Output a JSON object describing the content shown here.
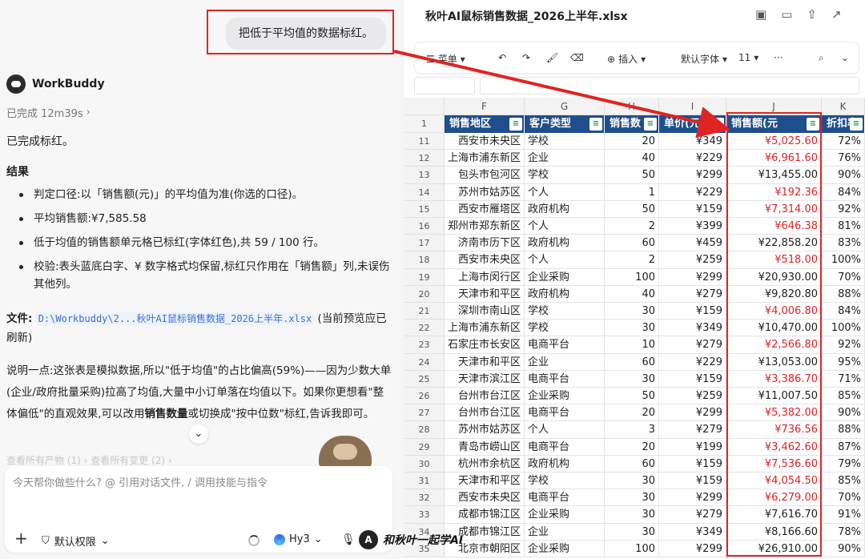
{
  "chat": {
    "user_message": "把低于平均值的数据标红。",
    "brand": "WorkBuddy",
    "status": "已完成 12m39s",
    "status_chevron": "›",
    "done_text": "已完成标红。",
    "result_title": "结果",
    "bullets": [
      "判定口径:以「销售额(元)」的平均值为准(你选的口径)。",
      "平均销售额:¥7,585.58",
      "低于均值的销售额单元格已标红(字体红色),共 59 / 100 行。",
      "校验:表头蓝底白字、¥ 数字格式均保留,标红只作用在「销售额」列,未误伤其他列。"
    ],
    "file_label": "文件:",
    "file_link": "D:\\Workbuddy\\2...秋叶AI鼠标销售数据_2026上半年.xlsx",
    "file_suffix": "(当前预览应已刷新)",
    "note_1": "说明一点:这张表是模拟数据,所以\"低于均值\"的占比偏高(59%)——因为少数大单(企业/政府批量采购)拉高了均值,大量中小订单落在均值以下。如果你更想看\"整体偏低\"的直观效果,可以改用",
    "note_bold_1": "销售数量",
    "note_2": "或切换成\"按中位数\"标红,告诉我即可。",
    "faded_links": "查看所有产物 (1) ›    查看所有变更 (2) ›",
    "composer_placeholder": "今天帮你做些什么? @ 引用对话文件, / 调用技能与指令",
    "permission": "默认权限",
    "model": "Hy3",
    "scroll_down": "⌄"
  },
  "watermark": "和秋叶一起学AI",
  "sheet": {
    "file_title": "秋叶AI鼠标销售数据_2026上半年.xlsx",
    "toolbar": {
      "menu": "菜单",
      "insert": "插入",
      "font": "默认字体",
      "font_size": "11",
      "more": "···"
    },
    "columns": [
      "F",
      "G",
      "H",
      "I",
      "J",
      "K"
    ],
    "header_row_num": "1",
    "headers": [
      "销售地区",
      "客户类型",
      "销售数",
      "单价(元",
      "销售额(元",
      "折扣率"
    ],
    "rows": [
      [
        "11",
        "西安市未央区",
        "学校",
        "20",
        "¥349",
        "¥5,025.60",
        "72%",
        true
      ],
      [
        "12",
        "上海市浦东新区",
        "企业",
        "40",
        "¥229",
        "¥6,961.60",
        "76%",
        true
      ],
      [
        "13",
        "包头市包河区",
        "学校",
        "50",
        "¥299",
        "¥13,455.00",
        "90%",
        false
      ],
      [
        "14",
        "苏州市姑苏区",
        "个人",
        "1",
        "¥229",
        "¥192.36",
        "84%",
        true
      ],
      [
        "15",
        "西安市雁塔区",
        "政府机构",
        "50",
        "¥159",
        "¥7,314.00",
        "92%",
        true
      ],
      [
        "16",
        "郑州市郑东新区",
        "个人",
        "2",
        "¥399",
        "¥646.38",
        "81%",
        true
      ],
      [
        "17",
        "济南市历下区",
        "政府机构",
        "60",
        "¥459",
        "¥22,858.20",
        "83%",
        false
      ],
      [
        "18",
        "西安市未央区",
        "个人",
        "2",
        "¥259",
        "¥518.00",
        "100%",
        true
      ],
      [
        "19",
        "上海市闵行区",
        "企业采购",
        "100",
        "¥299",
        "¥20,930.00",
        "70%",
        false
      ],
      [
        "20",
        "天津市和平区",
        "政府机构",
        "40",
        "¥279",
        "¥9,820.80",
        "88%",
        false
      ],
      [
        "21",
        "深圳市南山区",
        "学校",
        "30",
        "¥159",
        "¥4,006.80",
        "84%",
        true
      ],
      [
        "22",
        "上海市浦东新区",
        "学校",
        "30",
        "¥349",
        "¥10,470.00",
        "100%",
        false
      ],
      [
        "23",
        "石家庄市长安区",
        "电商平台",
        "10",
        "¥279",
        "¥2,566.80",
        "92%",
        true
      ],
      [
        "24",
        "天津市和平区",
        "企业",
        "60",
        "¥229",
        "¥13,053.00",
        "95%",
        false
      ],
      [
        "25",
        "天津市滨江区",
        "电商平台",
        "30",
        "¥159",
        "¥3,386.70",
        "71%",
        true
      ],
      [
        "26",
        "台州市台江区",
        "企业采购",
        "50",
        "¥259",
        "¥11,007.50",
        "85%",
        false
      ],
      [
        "27",
        "台州市台江区",
        "电商平台",
        "20",
        "¥299",
        "¥5,382.00",
        "90%",
        true
      ],
      [
        "28",
        "苏州市姑苏区",
        "个人",
        "3",
        "¥279",
        "¥736.56",
        "88%",
        true
      ],
      [
        "29",
        "青岛市崂山区",
        "电商平台",
        "20",
        "¥199",
        "¥3,462.60",
        "87%",
        true
      ],
      [
        "30",
        "杭州市余杭区",
        "政府机构",
        "60",
        "¥159",
        "¥7,536.60",
        "79%",
        true
      ],
      [
        "31",
        "天津市和平区",
        "学校",
        "30",
        "¥159",
        "¥4,054.50",
        "85%",
        true
      ],
      [
        "32",
        "西安市未央区",
        "电商平台",
        "30",
        "¥299",
        "¥6,279.00",
        "70%",
        true
      ],
      [
        "33",
        "成都市锦江区",
        "企业采购",
        "30",
        "¥279",
        "¥7,616.70",
        "91%",
        false
      ],
      [
        "34",
        "成都市锦江区",
        "企业",
        "30",
        "¥349",
        "¥8,166.60",
        "78%",
        false
      ],
      [
        "35",
        "北京市朝阳区",
        "企业采购",
        "100",
        "¥299",
        "¥26,910.00",
        "90%",
        false
      ]
    ]
  }
}
